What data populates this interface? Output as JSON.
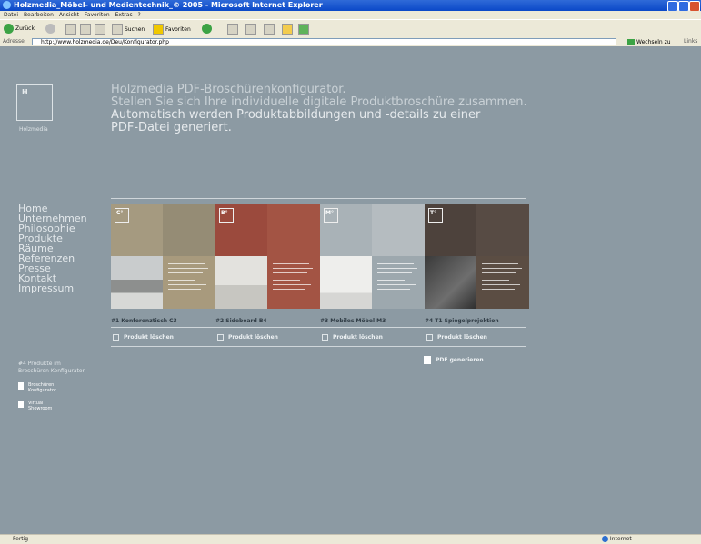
{
  "window": {
    "title": "Holzmedia_Möbel- und Medientechnik_© 2005 - Microsoft Internet Explorer"
  },
  "menu": [
    "Datei",
    "Bearbeiten",
    "Ansicht",
    "Favoriten",
    "Extras",
    "?"
  ],
  "toolbar": {
    "back": "Zurück",
    "search": "Suchen",
    "favorites": "Favoriten"
  },
  "address": {
    "label": "Adresse",
    "url": "http://www.holzmedia.de/Deu/Konfigurator.php",
    "go": "Wechseln zu",
    "links": "Links"
  },
  "logo": {
    "mark": "H",
    "name": "Holzmedia"
  },
  "headline": {
    "line1": "Holzmedia PDF-Broschürenkonfigurator.",
    "line2": "Stellen Sie sich Ihre individuelle digitale Produktbroschüre zusammen.",
    "line3": "Automatisch werden Produktabbildungen und -details zu einer",
    "line4": "PDF-Datei generiert."
  },
  "nav": [
    "Home",
    "Unternehmen",
    "Philosophie",
    "Produkte",
    "Räume",
    "Referenzen",
    "Presse",
    "Kontakt",
    "Impressum"
  ],
  "products": [
    {
      "letter": "C°",
      "label": "#1 Konferenztisch C3",
      "button": "Produkt löschen",
      "color_top": "#9a917a",
      "color_desc": "#a89a7d"
    },
    {
      "letter": "B°",
      "label": "#2 Sideboard B4",
      "button": "Produkt löschen",
      "color_top": "#9b4a3d",
      "color_desc": "#a35444"
    },
    {
      "letter": "M°",
      "label": "#3 Mobiles Möbel M3",
      "button": "Produkt löschen",
      "color_top": "#b0b8bd",
      "color_desc": "#9da8ae"
    },
    {
      "letter": "T°",
      "label": "#4 T1 Spiegelprojektion",
      "button": "Produkt löschen",
      "color_top": "#4d423c",
      "color_desc": "#5b4d43"
    }
  ],
  "generate": "PDF generieren",
  "sidebar": {
    "count_line1": "#4 Produkte im",
    "count_line2": "Broschüren Konfigurator",
    "link1_line1": "Broschüren",
    "link1_line2": "Konfigurator",
    "link2_line1": "Virtual",
    "link2_line2": "Showroom"
  },
  "status": {
    "left": "Fertig",
    "right": "Internet"
  }
}
